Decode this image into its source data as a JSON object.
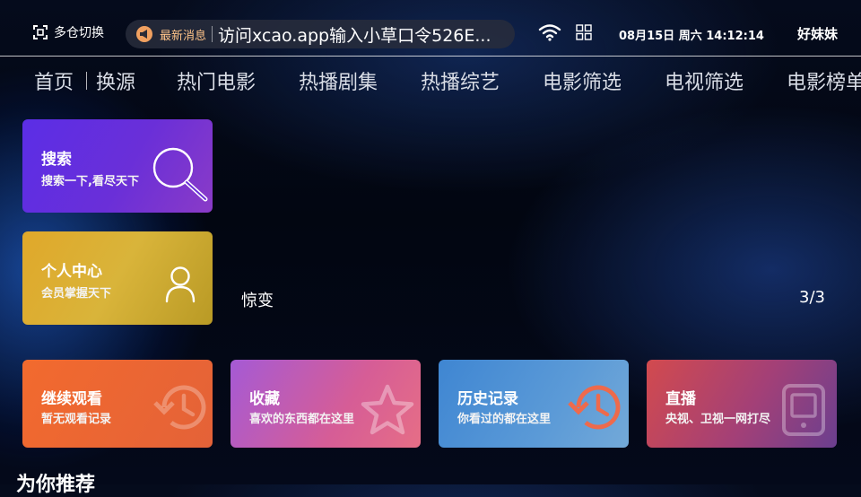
{
  "header": {
    "switch_label": "多仓切换",
    "notice_tag": "最新消息",
    "notice_text": "访问xcao.app输入小草口令526E...",
    "datetime": "08月15日 周六 14:12:14",
    "user": "好妹妹"
  },
  "nav": {
    "items": [
      "首页",
      "换源",
      "热门电影",
      "热播剧集",
      "热播综艺",
      "电影筛选",
      "电视筛选",
      "电影榜单"
    ]
  },
  "cards": {
    "search": {
      "title": "搜索",
      "subtitle": "搜索一下,看尽天下",
      "icon": "search-icon"
    },
    "personal": {
      "title": "个人中心",
      "subtitle": "会员掌握天下",
      "icon": "user-icon"
    },
    "continue": {
      "title": "继续观看",
      "subtitle": "暂无观看记录",
      "icon": "history-icon"
    },
    "favorites": {
      "title": "收藏",
      "subtitle": "喜欢的东西都在这里",
      "icon": "star-icon"
    },
    "history": {
      "title": "历史记录",
      "subtitle": "你看过的都在这里",
      "icon": "history-icon"
    },
    "live": {
      "title": "直播",
      "subtitle": "央视、卫视一网打尽",
      "icon": "tv-icon"
    }
  },
  "banner": {
    "title": "惊变",
    "page": "3/3"
  },
  "section": {
    "recommend": "为你推荐"
  },
  "colors": {
    "accent": "#5b2ee6",
    "notice_tag": "#ffc489"
  }
}
